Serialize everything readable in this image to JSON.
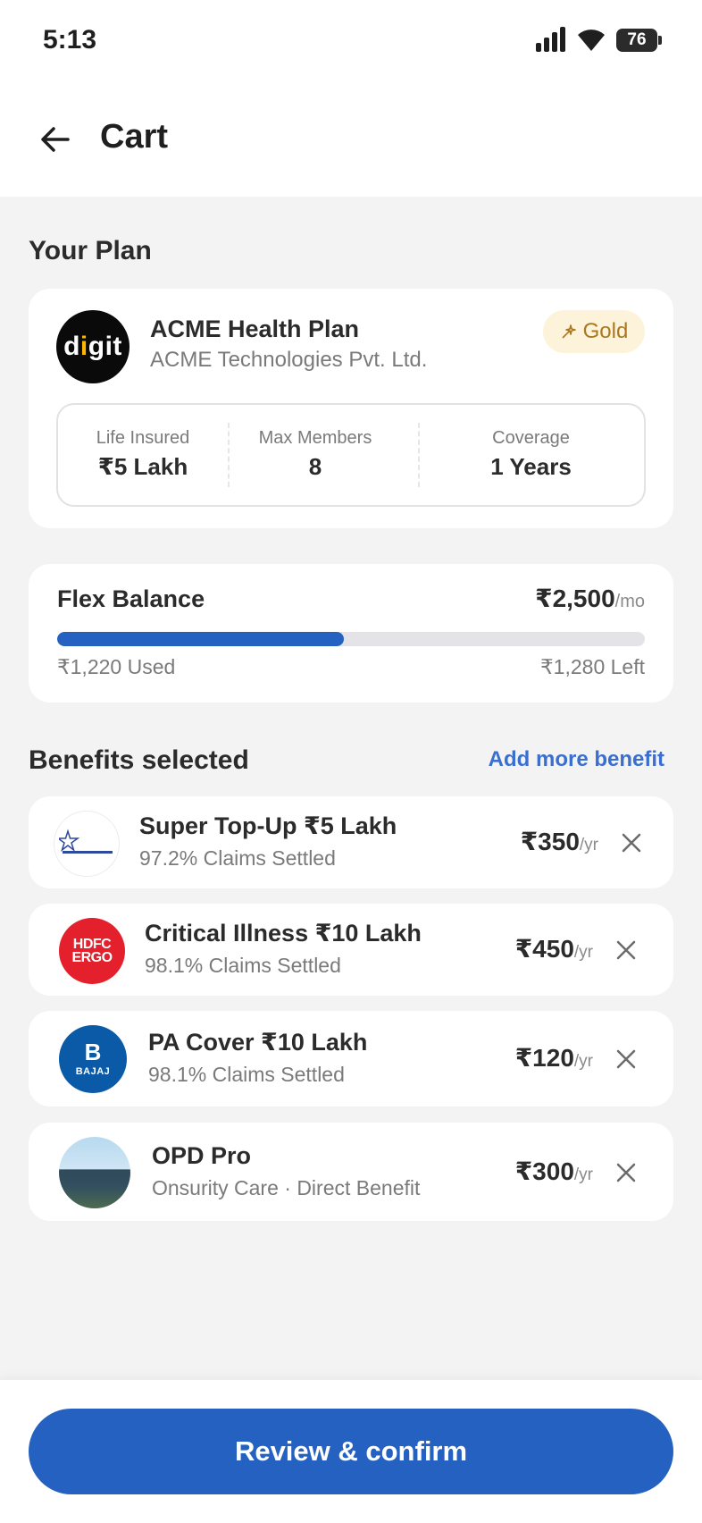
{
  "status_bar": {
    "time": "5:13",
    "battery": "76"
  },
  "header": {
    "title": "Cart"
  },
  "plan_section": {
    "title": "Your Plan"
  },
  "plan": {
    "logo_text": "digit",
    "name": "ACME Health Plan",
    "company": "ACME Technologies Pvt. Ltd.",
    "badge": "Gold",
    "stats": [
      {
        "label": "Life Insured",
        "value": "₹5 Lakh"
      },
      {
        "label": "Max Members",
        "value": "8"
      },
      {
        "label": "Coverage",
        "value": "1 Years"
      }
    ]
  },
  "flex": {
    "title": "Flex Balance",
    "amount": "₹2,500",
    "unit": "/mo",
    "used": "₹1,220 Used",
    "left": "₹1,280 Left",
    "used_fraction": 0.488
  },
  "benefits_section": {
    "title": "Benefits selected",
    "add_more": "Add more benefit"
  },
  "benefits": [
    {
      "name": "Super Top-Up ₹5 Lakh",
      "sub": "97.2% Claims Settled",
      "price": "₹350",
      "unit": "/yr",
      "logo": "STAR"
    },
    {
      "name": "Critical Illness ₹10 Lakh",
      "sub": "98.1% Claims Settled",
      "price": "₹450",
      "unit": "/yr",
      "logo_lines": [
        "HDFC",
        "ERGO"
      ]
    },
    {
      "name": "PA Cover ₹10 Lakh",
      "sub": "98.1% Claims Settled",
      "price": "₹120",
      "unit": "/yr",
      "logo": "BAJAJ"
    },
    {
      "name": "OPD Pro",
      "sub": "Onsurity Care · Direct Benefit",
      "price": "₹300",
      "unit": "/yr"
    }
  ],
  "footer": {
    "cta": "Review & confirm"
  },
  "colors": {
    "primary": "#2561c0",
    "link": "#3a6fd0",
    "gold_bg": "#fdf3da",
    "gold_text": "#a8781f"
  }
}
